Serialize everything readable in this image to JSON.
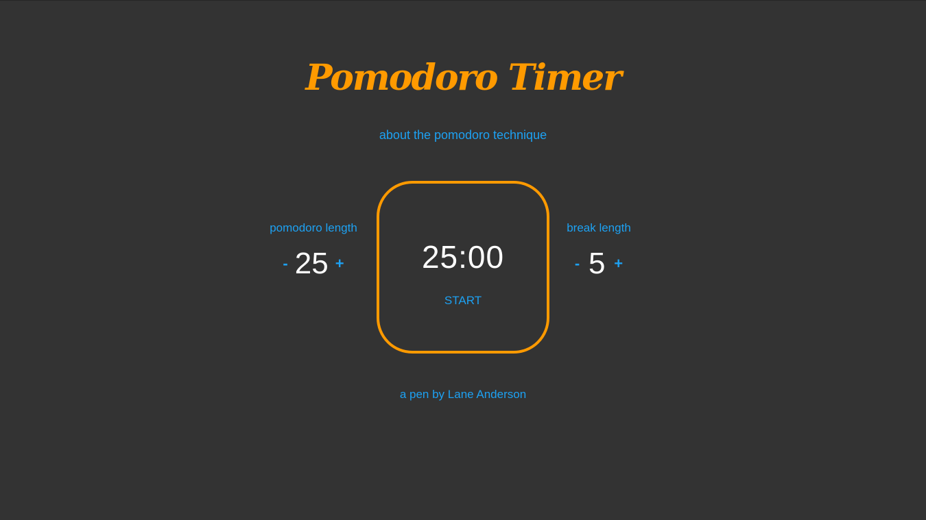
{
  "header": {
    "title": "Pomodoro Timer",
    "about_link": "about the pomodoro technique"
  },
  "pomodoro_setting": {
    "label": "pomodoro length",
    "decrement": "-",
    "value": "25",
    "increment": "+"
  },
  "break_setting": {
    "label": "break length",
    "decrement": "-",
    "value": "5",
    "increment": "+"
  },
  "timer": {
    "display": "25:00",
    "start_label": "START"
  },
  "footer": {
    "credit_prefix": "a pen by",
    "author": "Lane Anderson"
  },
  "colors": {
    "background": "#333333",
    "accent": "#ff9a00",
    "link": "#1da1f2",
    "text": "#ffffff"
  }
}
